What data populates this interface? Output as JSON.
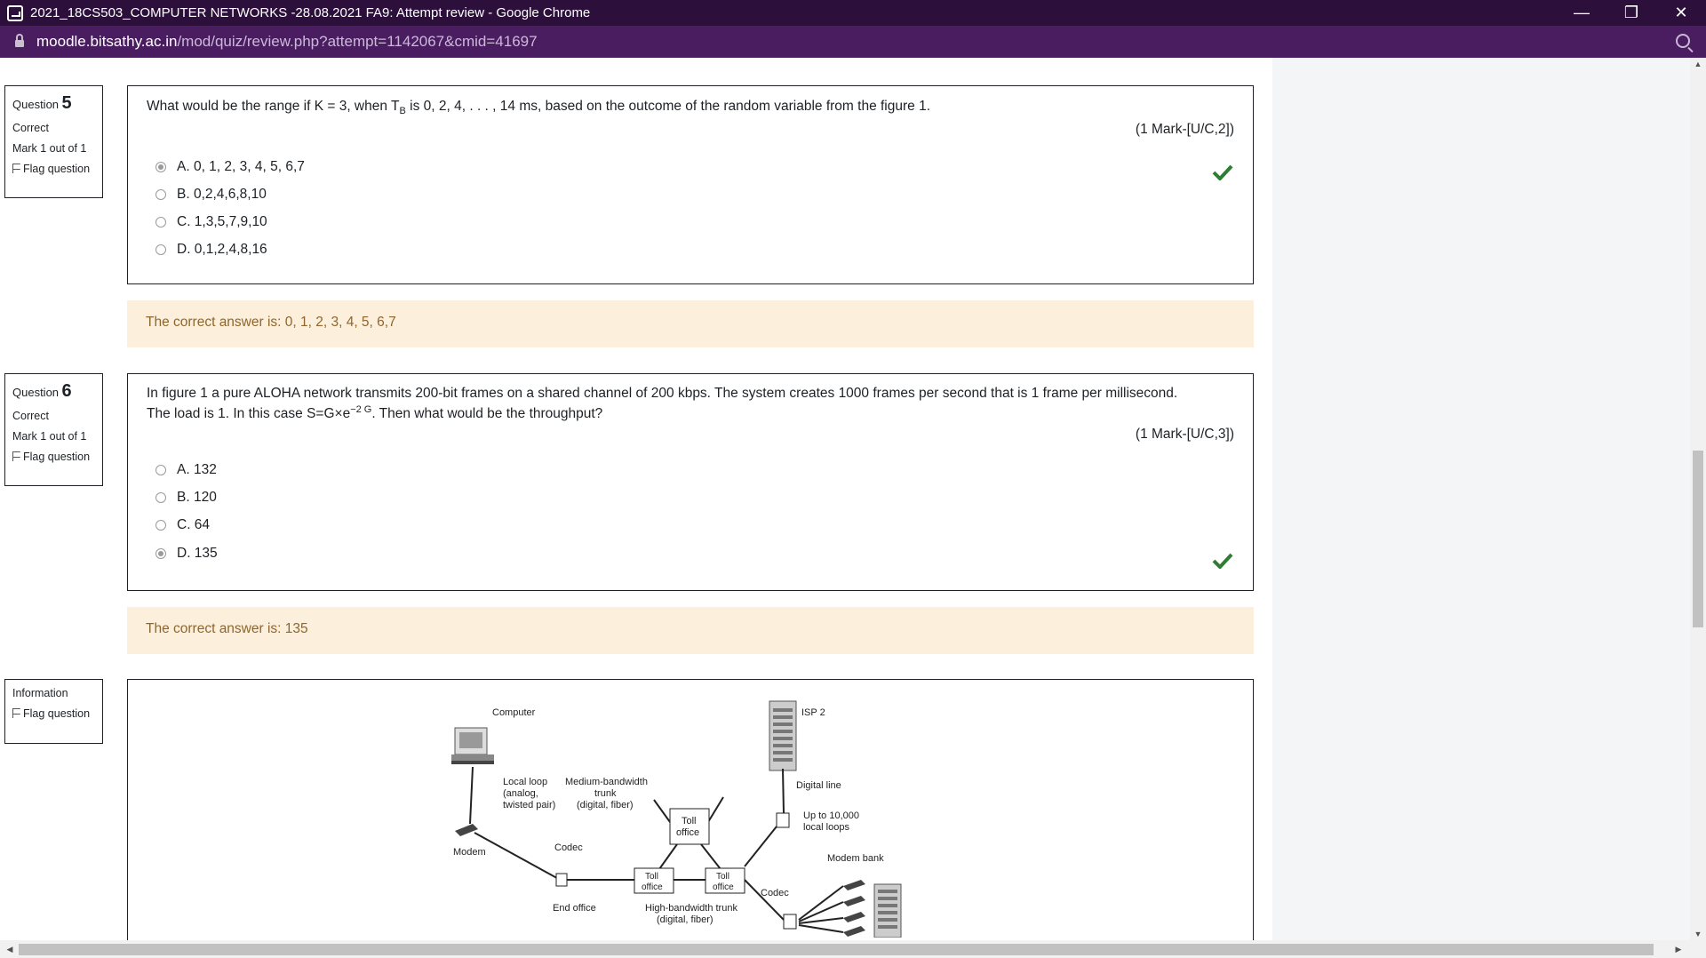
{
  "window": {
    "title": "2021_18CS503_COMPUTER NETWORKS -28.08.2021 FA9: Attempt review - Google Chrome",
    "url_domain": "moodle.bitsathy.ac.in",
    "url_path": "/mod/quiz/review.php?attempt=1142067&cmid=41697"
  },
  "questions": [
    {
      "label": "Question",
      "number": "5",
      "status": "Correct",
      "mark": "Mark 1 out of 1",
      "flag_label": "Flag question",
      "text_before_sub": "What would be the range if K = 3, when T",
      "text_sub": "B",
      "text_after_sub": " is 0, 2, 4, . . . , 14 ms, based on the outcome of the random variable from the figure 1.",
      "marks_label": "(1 Mark-[U/C,2])",
      "options": [
        {
          "label": "A. 0, 1, 2, 3, 4, 5, 6,7",
          "selected": true
        },
        {
          "label": "B. 0,2,4,6,8,10",
          "selected": false
        },
        {
          "label": "C. 1,3,5,7,9,10",
          "selected": false
        },
        {
          "label": "D. 0,1,2,4,8,16",
          "selected": false
        }
      ],
      "feedback": "The correct answer is: 0, 1, 2, 3, 4, 5, 6,7"
    },
    {
      "label": "Question",
      "number": "6",
      "status": "Correct",
      "mark": "Mark 1 out of 1",
      "flag_label": "Flag question",
      "text_line1": "In figure 1 a pure ALOHA network transmits 200-bit frames on a shared channel of 200 kbps. The system creates 1000 frames per second that is 1 frame per millisecond.",
      "text_line2_before_sup": "The load is 1. In this case S=G×e",
      "text_sup": "−2 G",
      "text_line2_after_sup": ". Then what would be the throughput?",
      "marks_label": "(1 Mark-[U/C,3])",
      "options": [
        {
          "label": "A. 132",
          "selected": false
        },
        {
          "label": "B. 120",
          "selected": false
        },
        {
          "label": "C. 64",
          "selected": false
        },
        {
          "label": "D. 135",
          "selected": true
        }
      ],
      "feedback": "The correct answer is: 135"
    }
  ],
  "information": {
    "label": "Information",
    "flag_label": "Flag question",
    "figure_labels": {
      "computer": "Computer",
      "isp2": "ISP 2",
      "local_loop_1": "Local loop",
      "local_loop_2": "(analog,",
      "local_loop_3": "twisted pair)",
      "medium_1": "Medium-bandwidth",
      "medium_2": "trunk",
      "medium_3": "(digital, fiber)",
      "toll_office": "Toll",
      "toll_office_2": "office",
      "digital_line": "Digital line",
      "up_to_1": "Up to 10,000",
      "up_to_2": "local loops",
      "modem": "Modem",
      "codec": "Codec",
      "modem_bank": "Modem bank",
      "end_office": "End office",
      "high_1": "High-bandwidth trunk",
      "high_2": "(digital, fiber)"
    }
  },
  "icons": {
    "check_color": "#2e7d32",
    "titlebar_color": "#2c0f3b",
    "addressbar_color": "#4a1d60"
  }
}
